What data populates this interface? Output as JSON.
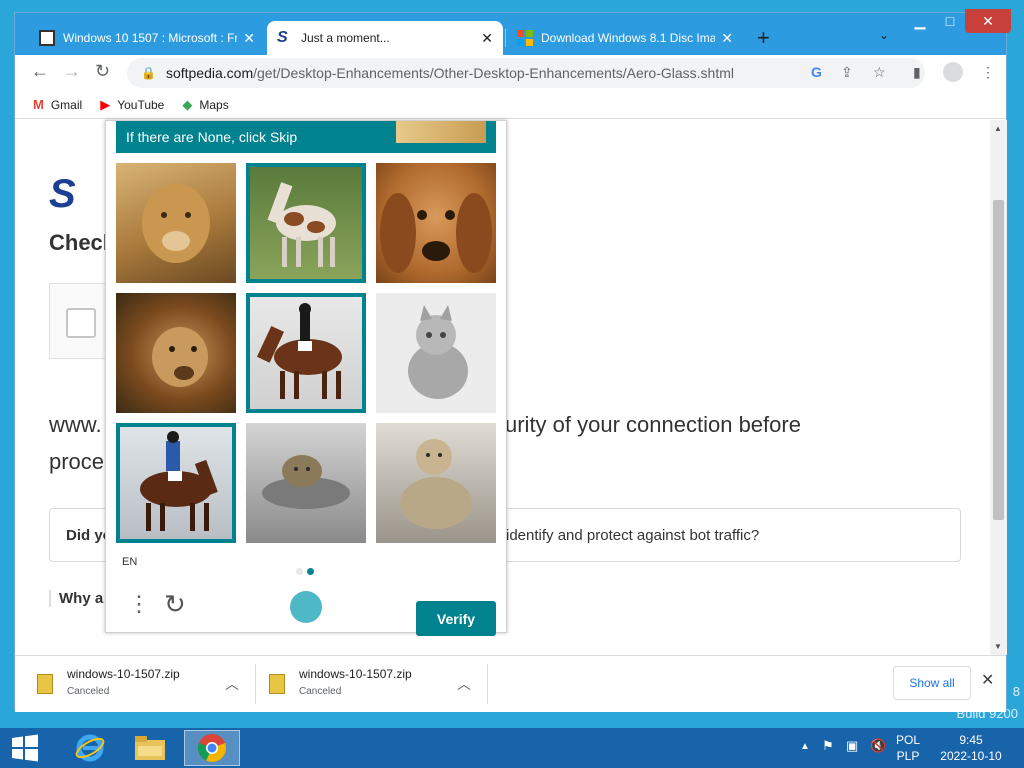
{
  "browser": {
    "tabs": [
      {
        "title": "Windows 10 1507 : Microsoft : Fr",
        "active": false
      },
      {
        "title": "Just a moment...",
        "active": true
      },
      {
        "title": "Download Windows 8.1 Disc Ima",
        "active": false
      }
    ],
    "url_domain": "softpedia.com",
    "url_path": "/get/Desktop-Enhancements/Other-Desktop-Enhancements/Aero-Glass.shtml",
    "bookmarks": [
      "Gmail",
      "YouTube",
      "Maps"
    ]
  },
  "page": {
    "check_text": "Checl",
    "verify_text_left": "www.",
    "verify_text_right": "urity of your connection before",
    "verify_text_line2": "proce",
    "question_left": "Did yo",
    "question_right": "identify and protect against bot traffic?",
    "why_text": "Why a"
  },
  "captcha": {
    "instruction": "If there are None, click Skip",
    "language": "EN",
    "verify_label": "Verify",
    "cells": [
      {
        "subject": "lion",
        "selected": false
      },
      {
        "subject": "horse",
        "selected": true
      },
      {
        "subject": "dog",
        "selected": false
      },
      {
        "subject": "lion",
        "selected": false
      },
      {
        "subject": "horse",
        "selected": true
      },
      {
        "subject": "cat",
        "selected": false
      },
      {
        "subject": "horse",
        "selected": true
      },
      {
        "subject": "lion",
        "selected": false
      },
      {
        "subject": "lion",
        "selected": false
      }
    ],
    "accent": "#00838f"
  },
  "downloads": {
    "items": [
      {
        "name": "windows-10-1507.zip",
        "status": "Canceled"
      },
      {
        "name": "windows-10-1507.zip",
        "status": "Canceled"
      }
    ],
    "show_all_label": "Show all"
  },
  "taskbar": {
    "lang_top": "POL",
    "lang_bottom": "PLP",
    "time": "9:45",
    "date": "2022-10-10"
  },
  "desktop": {
    "watermark": "Build 9200",
    "watermark2": "8"
  }
}
